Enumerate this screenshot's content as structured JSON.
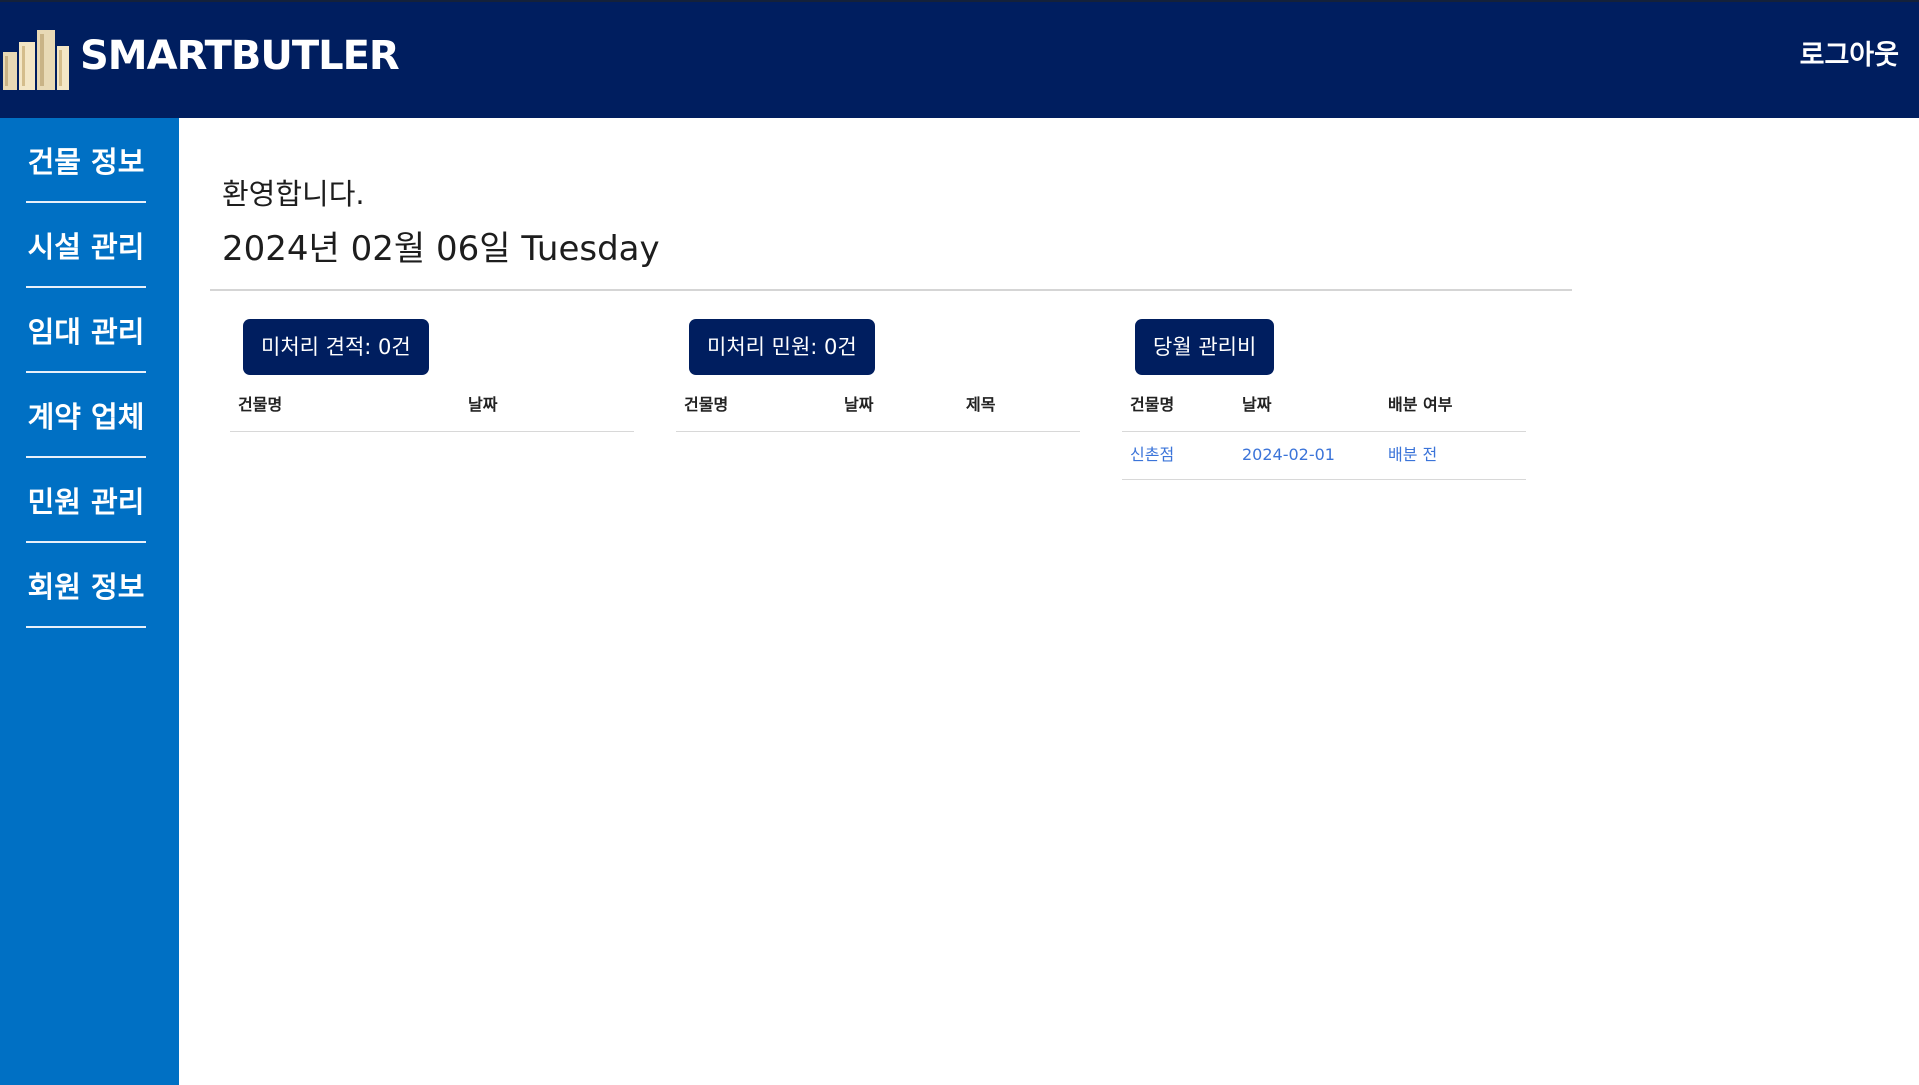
{
  "header": {
    "brand": "SMARTBUTLER",
    "logo_icon": "buildings-icon",
    "logout_label": "로그아웃",
    "background_color": "#001e5f"
  },
  "sidebar": {
    "background_color": "#0070c4",
    "items": [
      {
        "label": "건물 정보"
      },
      {
        "label": "시설 관리"
      },
      {
        "label": "임대 관리"
      },
      {
        "label": "계약 업체"
      },
      {
        "label": "민원 관리"
      },
      {
        "label": "회원 정보"
      }
    ]
  },
  "main": {
    "welcome": "환영합니다.",
    "date": "2024년 02월 06일 Tuesday",
    "panels": [
      {
        "button_label": "미처리 견적: 0건",
        "columns": [
          "건물명",
          "날짜"
        ],
        "rows": []
      },
      {
        "button_label": "미처리 민원: 0건",
        "columns": [
          "건물명",
          "날짜",
          "제목"
        ],
        "rows": []
      },
      {
        "button_label": "당월 관리비",
        "columns": [
          "건물명",
          "날짜",
          "배분 여부"
        ],
        "rows": [
          [
            "신촌점",
            "2024-02-01",
            "배분 전"
          ]
        ]
      }
    ]
  },
  "colors": {
    "accent_dark": "#001e5f",
    "sidebar_blue": "#0070c4",
    "link_blue": "#3b74d9"
  }
}
